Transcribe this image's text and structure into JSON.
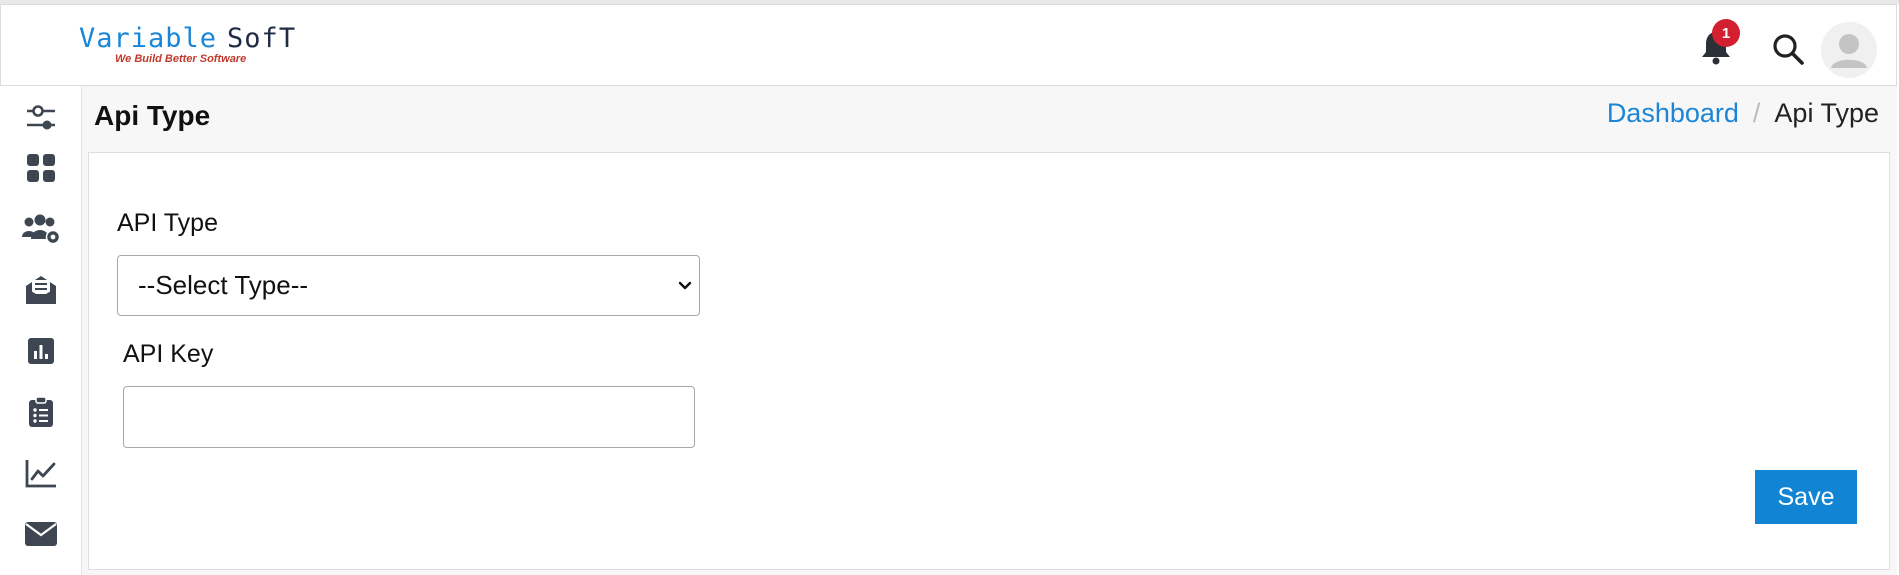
{
  "header": {
    "logo_text_1": "Variable",
    "logo_text_2": "SofT",
    "logo_tagline": "We Build Better Software",
    "notification_count": "1"
  },
  "sidebar": {
    "items": [
      {
        "icon": "sliders-icon"
      },
      {
        "icon": "dashboard-grid-icon"
      },
      {
        "icon": "users-settings-icon"
      },
      {
        "icon": "mail-open-icon"
      },
      {
        "icon": "report-chart-icon"
      },
      {
        "icon": "clipboard-list-icon"
      },
      {
        "icon": "line-chart-icon"
      },
      {
        "icon": "envelope-icon"
      }
    ]
  },
  "page": {
    "title": "Api Type",
    "breadcrumb": {
      "home": "Dashboard",
      "separator": "/",
      "current": "Api Type"
    }
  },
  "form": {
    "api_type_label": "API Type",
    "api_type_selected": "--Select Type--",
    "api_key_label": "API Key",
    "api_key_value": "",
    "save_label": "Save"
  },
  "colors": {
    "accent": "#1284d4",
    "badge": "#d32030",
    "icon": "#3e4652"
  }
}
